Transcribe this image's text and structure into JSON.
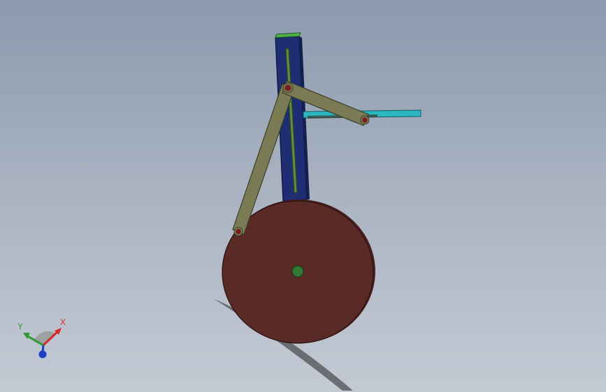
{
  "viewport": {
    "background_top": "#8b9aae",
    "background_bottom": "#c4cad4"
  },
  "model": {
    "colors": {
      "column": "#1f2d72",
      "column_cap": "#4fb14a",
      "slot": "#5b8f3c",
      "rod": "#2ab7c0",
      "link": "#7a7a54",
      "link_edge": "#3e3e28",
      "disc": "#5a2a27",
      "pin": "#7a1d1d",
      "hub": "#2f7a34",
      "shadow": "#222222"
    }
  },
  "triad": {
    "x_label": "X",
    "y_label": "Y",
    "x_color": "#d62a2a",
    "y_color": "#2f9a2f",
    "z_color": "#1b3fc4"
  }
}
